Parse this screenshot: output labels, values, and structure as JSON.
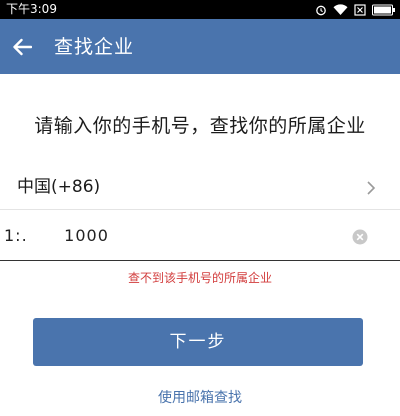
{
  "status_bar": {
    "time": "下午3:09",
    "icons": [
      "alarm-icon",
      "wifi-icon",
      "no-sim-icon",
      "battery-icon"
    ]
  },
  "app_bar": {
    "title": "查找企业",
    "back_icon": "back-arrow-icon",
    "background_color": "#4a74ad"
  },
  "prompt": "请输入你的手机号，查找你的所属企业",
  "country_selector": {
    "label": "中国(+86)",
    "icon": "chevron-right-icon"
  },
  "phone_field": {
    "value": "1:.      1000",
    "clear_icon": "clear-icon"
  },
  "error_message": "查不到该手机号的所属企业",
  "next_button": {
    "label": "下一步"
  },
  "email_link": "使用邮箱查找",
  "colors": {
    "primary": "#4a74ad",
    "error": "#d23c3c",
    "text": "#1c1c1c"
  }
}
